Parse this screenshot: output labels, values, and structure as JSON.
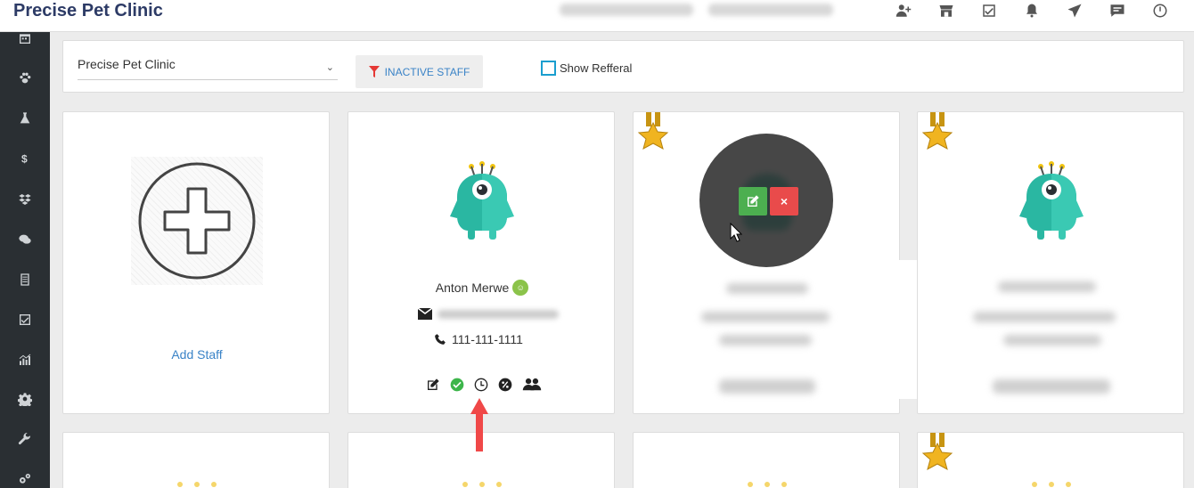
{
  "app": {
    "brand": "Precise Pet Clinic"
  },
  "topbar": {
    "icons": [
      "user-plus-icon",
      "store-icon",
      "checkbox-icon",
      "bell-icon",
      "send-icon",
      "chat-icon",
      "clock-icon"
    ]
  },
  "sidebar": {
    "icons": [
      "calendar-icon",
      "paw-icon",
      "flask-icon",
      "dollar-icon",
      "dropbox-icon",
      "chat-icon",
      "list-icon",
      "check-icon",
      "chart-icon",
      "gear-icon",
      "wrench-icon",
      "gears-icon"
    ]
  },
  "filters": {
    "clinic_select_value": "Precise Pet Clinic",
    "inactive_label": "INACTIVE STAFF",
    "referral_label": "Show Refferal",
    "referral_checked": false
  },
  "cards": {
    "add_label": "Add Staff",
    "staff1": {
      "name": "Anton Merwe",
      "phone": "111-111-1111"
    }
  },
  "colors": {
    "brand": "#2d3b66",
    "accent_link": "#3a83c7",
    "sidebar_bg": "#2a2f33",
    "monster_teal": "#2ab7a2",
    "edit_green": "#4caf50",
    "delete_red": "#e94b4b",
    "medal_gold": "#f0b420"
  }
}
